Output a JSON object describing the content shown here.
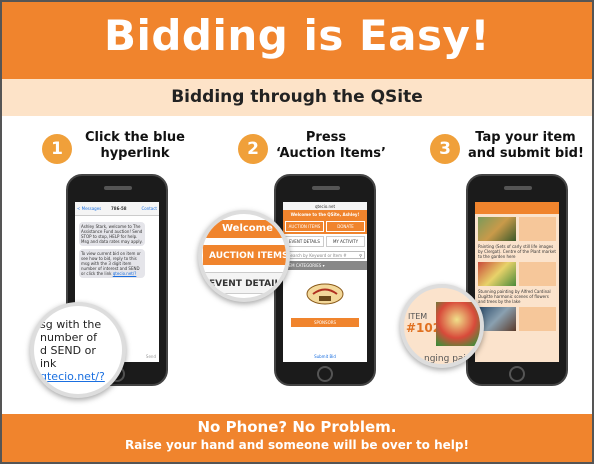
{
  "header": {
    "title": "Bidding is Easy!",
    "subtitle": "Bidding through the QSite"
  },
  "steps": [
    {
      "number": "1",
      "line1": "Click the blue",
      "line2": "hyperlink"
    },
    {
      "number": "2",
      "line1": "Press",
      "line2": "‘Auction Items’"
    },
    {
      "number": "3",
      "line1": "Tap your item",
      "line2": "and submit bid!"
    }
  ],
  "phone1": {
    "back_label": "< Messages",
    "number": "786-58",
    "contact": "Contact",
    "msg1": "Ashley Stark, welcome to The Assistance Fund auction! Send STOP to stop, HELP for help. Msg and data rates may apply.",
    "msg2": "To view current bid on item or see how to bid, reply to this msg with the 3 digit item number of interest and SEND or click the link",
    "link": "qtecio.net/?",
    "send": "Send",
    "mag_line1": "sg with the",
    "mag_line2": "number of",
    "mag_line3": "d SEND or",
    "mag_line4": "ink",
    "mag_link": "qtecio.net/?"
  },
  "phone2": {
    "url": "qtecio.net",
    "welcome": "Welcome to the QSite, Ashley!",
    "btn_auction": "AUCTION ITEMS",
    "btn_donate": "DONATE",
    "btn_event": "EVENT DETAILS",
    "btn_activity": "MY ACTIVITY",
    "search_placeholder": "Search by Keyword or Item #",
    "categories": "ITEM CATEGORIES ▾",
    "sponsors": "SPONSORS",
    "footer": "Submit Bid",
    "mag_welcome": "Welcome",
    "mag_auction": "AUCTION ITEMS",
    "mag_event": "EVENT DETAIL"
  },
  "phone3": {
    "item1_desc": "Painting (Sets of carly still life images by Clergat). Centre of the Plant market to the garden here",
    "item2_desc": "Stunning painting by Alfred Cardinal Dugitte harmonic scenes of flowers and trees by the lake",
    "mag_item_label": "ITEM",
    "mag_item_number": "#102",
    "mag_caption": "nging pai"
  },
  "footer": {
    "line1": "No Phone? No Problem.",
    "line2": "Raise your hand and someone will be over to help!"
  }
}
